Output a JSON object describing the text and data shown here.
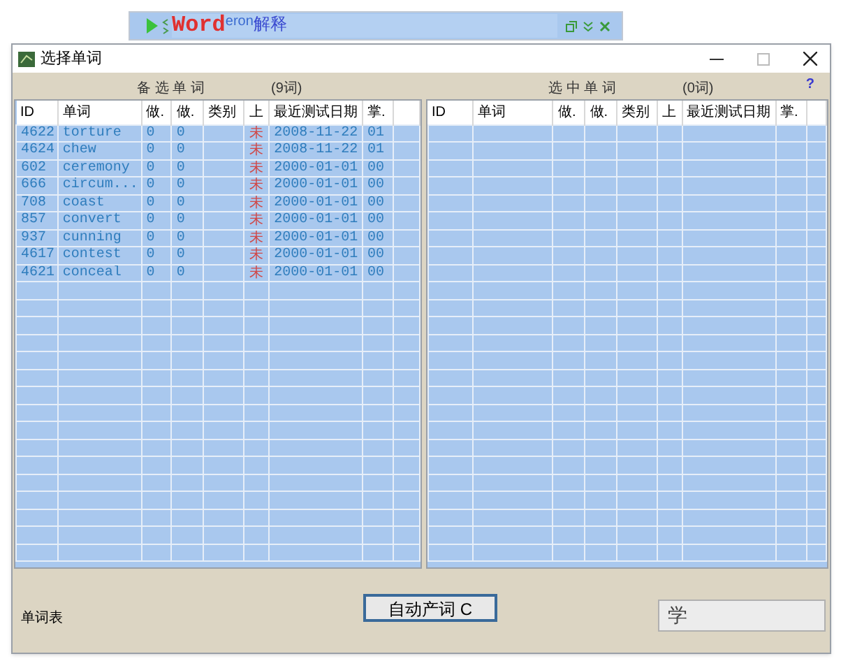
{
  "toolbar": {
    "logo": "Word",
    "logo_suffix": "eron",
    "title": "解释"
  },
  "window": {
    "title": "选择单词"
  },
  "help": "?",
  "left_panel": {
    "title": "备 选 单 词",
    "count": "(9词)",
    "columns": [
      "ID",
      "单词",
      "做.",
      "做.",
      "类别",
      "上",
      "最近测试日期",
      "掌."
    ],
    "rows": [
      [
        "4622",
        "torture",
        "0",
        "0",
        "",
        "未",
        "2008-11-22",
        "01"
      ],
      [
        "4624",
        "chew",
        "0",
        "0",
        "",
        "未",
        "2008-11-22",
        "01"
      ],
      [
        "602",
        "ceremony",
        "0",
        "0",
        "",
        "未",
        "2000-01-01",
        "00"
      ],
      [
        "666",
        "circum...",
        "0",
        "0",
        "",
        "未",
        "2000-01-01",
        "00"
      ],
      [
        "708",
        "coast",
        "0",
        "0",
        "",
        "未",
        "2000-01-01",
        "00"
      ],
      [
        "857",
        "convert",
        "0",
        "0",
        "",
        "未",
        "2000-01-01",
        "00"
      ],
      [
        "937",
        "cunning",
        "0",
        "0",
        "",
        "未",
        "2000-01-01",
        "00"
      ],
      [
        "4617",
        "contest",
        "0",
        "0",
        "",
        "未",
        "2000-01-01",
        "00"
      ],
      [
        "4621",
        "conceal",
        "0",
        "0",
        "",
        "未",
        "2000-01-01",
        "00"
      ]
    ]
  },
  "right_panel": {
    "title": "选 中 单 词",
    "count": "(0词)",
    "columns": [
      "ID",
      "单词",
      "做.",
      "做.",
      "类别",
      "上",
      "最近测试日期",
      "掌."
    ]
  },
  "footer": {
    "label": "单词表",
    "buttons": [
      "自动产词 C",
      "学"
    ]
  }
}
